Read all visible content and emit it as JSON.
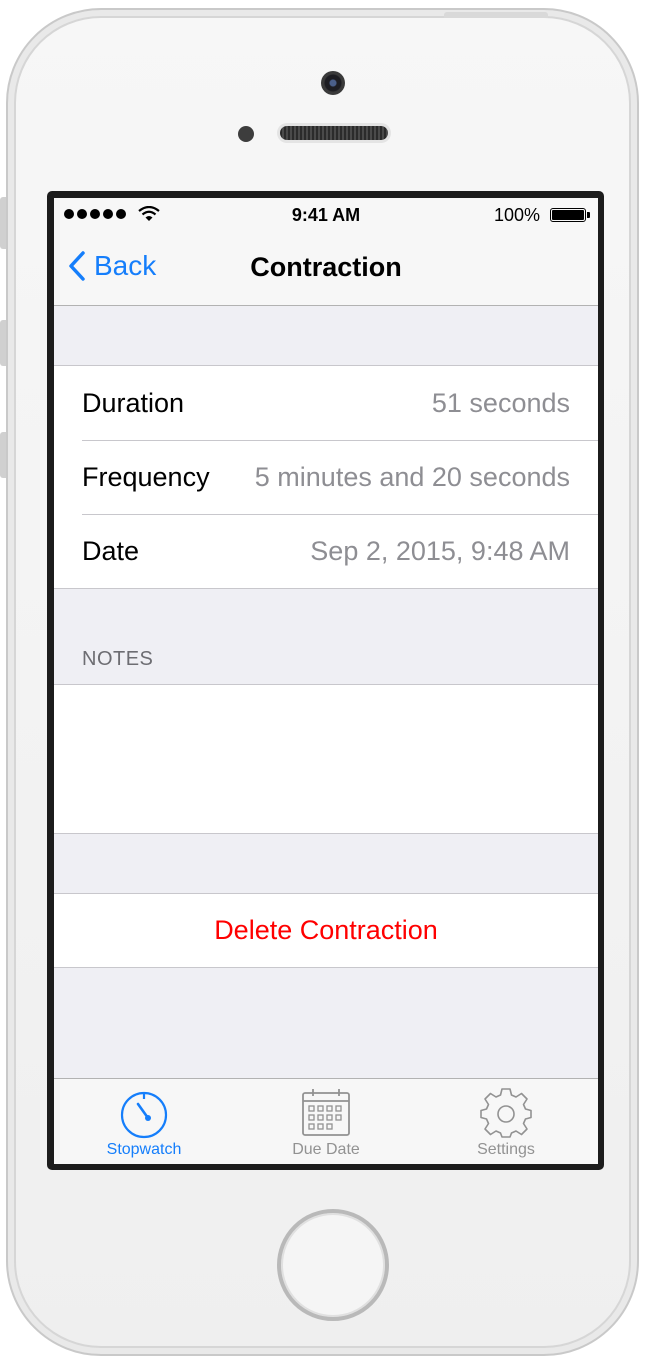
{
  "status": {
    "time": "9:41 AM",
    "battery": "100%"
  },
  "nav": {
    "back_label": "Back",
    "title": "Contraction"
  },
  "details": [
    {
      "label": "Duration",
      "value": "51 seconds"
    },
    {
      "label": "Frequency",
      "value": "5 minutes and 20 seconds"
    },
    {
      "label": "Date",
      "value": "Sep 2, 2015, 9:48 AM"
    }
  ],
  "notes": {
    "header": "NOTES",
    "text": ""
  },
  "actions": {
    "delete_label": "Delete Contraction"
  },
  "tabs": [
    {
      "label": "Stopwatch",
      "icon": "stopwatch-icon",
      "selected": true
    },
    {
      "label": "Due Date",
      "icon": "calendar-icon",
      "selected": false
    },
    {
      "label": "Settings",
      "icon": "gear-icon",
      "selected": false
    }
  ],
  "colors": {
    "tint": "#157efb",
    "destructive": "#ff0000",
    "inactive": "#929292",
    "secondary_text": "#8e8e93"
  }
}
